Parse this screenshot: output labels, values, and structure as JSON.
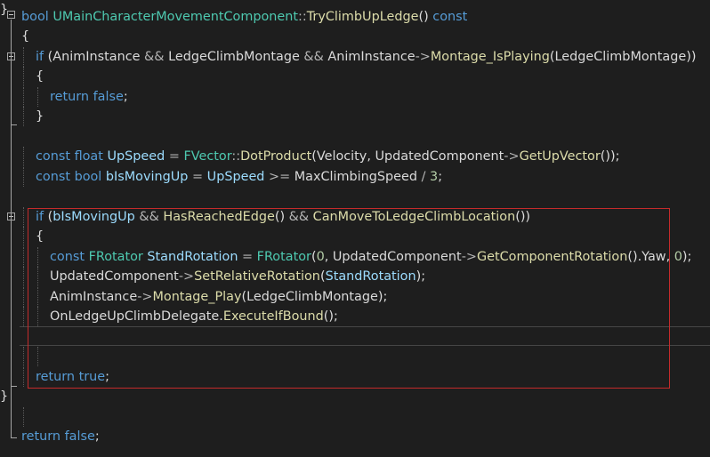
{
  "editor": {
    "lines": [
      [
        {
          "t": "bool",
          "c": "kw"
        },
        {
          "t": " "
        },
        {
          "t": "UMainCharacterMovementComponent",
          "c": "ty"
        },
        {
          "t": "::",
          "c": "op"
        },
        {
          "t": "TryClimbUpLedge",
          "c": "fn"
        },
        {
          "t": "() "
        },
        {
          "t": "const",
          "c": "kw"
        }
      ],
      [
        {
          "t": "{"
        }
      ],
      [
        {
          "t": "if",
          "c": "kw"
        },
        {
          "t": " ("
        },
        {
          "t": "AnimInstance",
          "c": "mv"
        },
        {
          "t": " && ",
          "c": "op"
        },
        {
          "t": "LedgeClimbMontage",
          "c": "mv"
        },
        {
          "t": " && ",
          "c": "op"
        },
        {
          "t": "AnimInstance",
          "c": "mv"
        },
        {
          "t": "->",
          "c": "op"
        },
        {
          "t": "Montage_IsPlaying",
          "c": "fn"
        },
        {
          "t": "("
        },
        {
          "t": "LedgeClimbMontage",
          "c": "mv"
        },
        {
          "t": "))"
        }
      ],
      [
        {
          "t": "{"
        }
      ],
      [
        {
          "t": "return",
          "c": "kw"
        },
        {
          "t": " "
        },
        {
          "t": "false",
          "c": "kw"
        },
        {
          "t": ";"
        }
      ],
      [
        {
          "t": "}"
        }
      ],
      [],
      [
        {
          "t": "const",
          "c": "kw"
        },
        {
          "t": " "
        },
        {
          "t": "float",
          "c": "kw"
        },
        {
          "t": " "
        },
        {
          "t": "UpSpeed",
          "c": "pm"
        },
        {
          "t": " = ",
          "c": "op"
        },
        {
          "t": "FVector",
          "c": "ty"
        },
        {
          "t": "::",
          "c": "op"
        },
        {
          "t": "DotProduct",
          "c": "fn"
        },
        {
          "t": "("
        },
        {
          "t": "Velocity",
          "c": "mv"
        },
        {
          "t": ", "
        },
        {
          "t": "UpdatedComponent",
          "c": "mv"
        },
        {
          "t": "->",
          "c": "op"
        },
        {
          "t": "GetUpVector",
          "c": "fn"
        },
        {
          "t": "());"
        }
      ],
      [
        {
          "t": "const",
          "c": "kw"
        },
        {
          "t": " "
        },
        {
          "t": "bool",
          "c": "kw"
        },
        {
          "t": " "
        },
        {
          "t": "bIsMovingUp",
          "c": "pm"
        },
        {
          "t": " = ",
          "c": "op"
        },
        {
          "t": "UpSpeed",
          "c": "pm"
        },
        {
          "t": " >= ",
          "c": "op"
        },
        {
          "t": "MaxClimbingSpeed",
          "c": "mv"
        },
        {
          "t": " / ",
          "c": "op"
        },
        {
          "t": "3",
          "c": "nm"
        },
        {
          "t": ";"
        }
      ],
      [],
      [
        {
          "t": "if",
          "c": "kw"
        },
        {
          "t": " ("
        },
        {
          "t": "bIsMovingUp",
          "c": "pm"
        },
        {
          "t": " && ",
          "c": "op"
        },
        {
          "t": "HasReachedEdge",
          "c": "fn"
        },
        {
          "t": "() "
        },
        {
          "t": "&&",
          "c": "op"
        },
        {
          "t": " "
        },
        {
          "t": "CanMoveToLedgeClimbLocation",
          "c": "fn"
        },
        {
          "t": "())"
        }
      ],
      [
        {
          "t": "{"
        }
      ],
      [
        {
          "t": "const",
          "c": "kw"
        },
        {
          "t": " "
        },
        {
          "t": "FRotator",
          "c": "ty"
        },
        {
          "t": " "
        },
        {
          "t": "StandRotation",
          "c": "pm"
        },
        {
          "t": " = ",
          "c": "op"
        },
        {
          "t": "FRotator",
          "c": "ty"
        },
        {
          "t": "("
        },
        {
          "t": "0",
          "c": "nm"
        },
        {
          "t": ", "
        },
        {
          "t": "UpdatedComponent",
          "c": "mv"
        },
        {
          "t": "->",
          "c": "op"
        },
        {
          "t": "GetComponentRotation",
          "c": "fn"
        },
        {
          "t": "()."
        },
        {
          "t": "Yaw",
          "c": "mv"
        },
        {
          "t": ", "
        },
        {
          "t": "0",
          "c": "nm"
        },
        {
          "t": ");"
        }
      ],
      [
        {
          "t": "UpdatedComponent",
          "c": "mv"
        },
        {
          "t": "->",
          "c": "op"
        },
        {
          "t": "SetRelativeRotation",
          "c": "fn"
        },
        {
          "t": "("
        },
        {
          "t": "StandRotation",
          "c": "pm"
        },
        {
          "t": ");"
        }
      ],
      [
        {
          "t": "AnimInstance",
          "c": "mv"
        },
        {
          "t": "->",
          "c": "op"
        },
        {
          "t": "Montage_Play",
          "c": "fn"
        },
        {
          "t": "("
        },
        {
          "t": "LedgeClimbMontage",
          "c": "mv"
        },
        {
          "t": ");"
        }
      ],
      [
        {
          "t": "OnLedgeUpClimbDelegate",
          "c": "mv"
        },
        {
          "t": "."
        },
        {
          "t": "ExecuteIfBound",
          "c": "fn"
        },
        {
          "t": "();"
        }
      ],
      [],
      [],
      [
        {
          "t": "return",
          "c": "kw"
        },
        {
          "t": " "
        },
        {
          "t": "true",
          "c": "kw"
        },
        {
          "t": ";"
        }
      ],
      [
        {
          "t": "}"
        }
      ],
      [],
      [
        {
          "t": "return",
          "c": "kw"
        },
        {
          "t": " "
        },
        {
          "t": "false",
          "c": "kw"
        },
        {
          "t": ";"
        }
      ],
      [
        {
          "t": "}"
        }
      ]
    ]
  }
}
